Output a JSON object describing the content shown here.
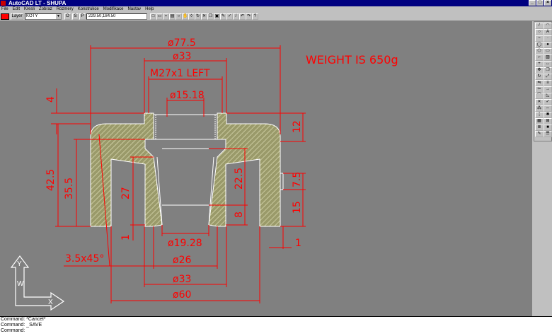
{
  "window": {
    "title": "AutoCAD LT - SHUPA"
  },
  "menu": [
    "File",
    "Edit",
    "Kresli",
    "Zobraz",
    "Rozmery",
    "Konstrukce",
    "Modifikace",
    "Nastav",
    "Help"
  ],
  "toolbar": {
    "layer_button": "Layer",
    "layer_name": "KOTY",
    "toggle_o": "O",
    "toggle_s": "S",
    "toggle_p": "P",
    "coordinates": "229.50,184.50",
    "current_color": "#ff0000"
  },
  "drawing": {
    "background": "#808080",
    "dimension_color": "#ff0000",
    "geometry_color": "#ffffff",
    "section_color": "#e8e8c0",
    "note": "WEIGHT IS 650g",
    "thread": "M27x1 LEFT",
    "dimensions": {
      "d77_5": "ø77.5",
      "d33_top": "ø33",
      "d15_18": "ø15.18",
      "d19_28": "ø19.28",
      "d26": "ø26",
      "d33_bottom": "ø33",
      "d60": "ø60",
      "chamfer": "3.5x45°",
      "h4": "4",
      "h42_5": "42.5",
      "h35_5": "35.5",
      "h27": "27",
      "h1_left": "1",
      "h22_5": "22.5",
      "h8": "8",
      "h12": "12",
      "h7_5": "7.5",
      "h15": "15",
      "h1_right": "1"
    },
    "ucs": {
      "y": "Y",
      "w": "W",
      "x": "X"
    }
  },
  "command_lines": [
    "Command: *Cancel*",
    "Command: _SAVE",
    "Command:"
  ]
}
